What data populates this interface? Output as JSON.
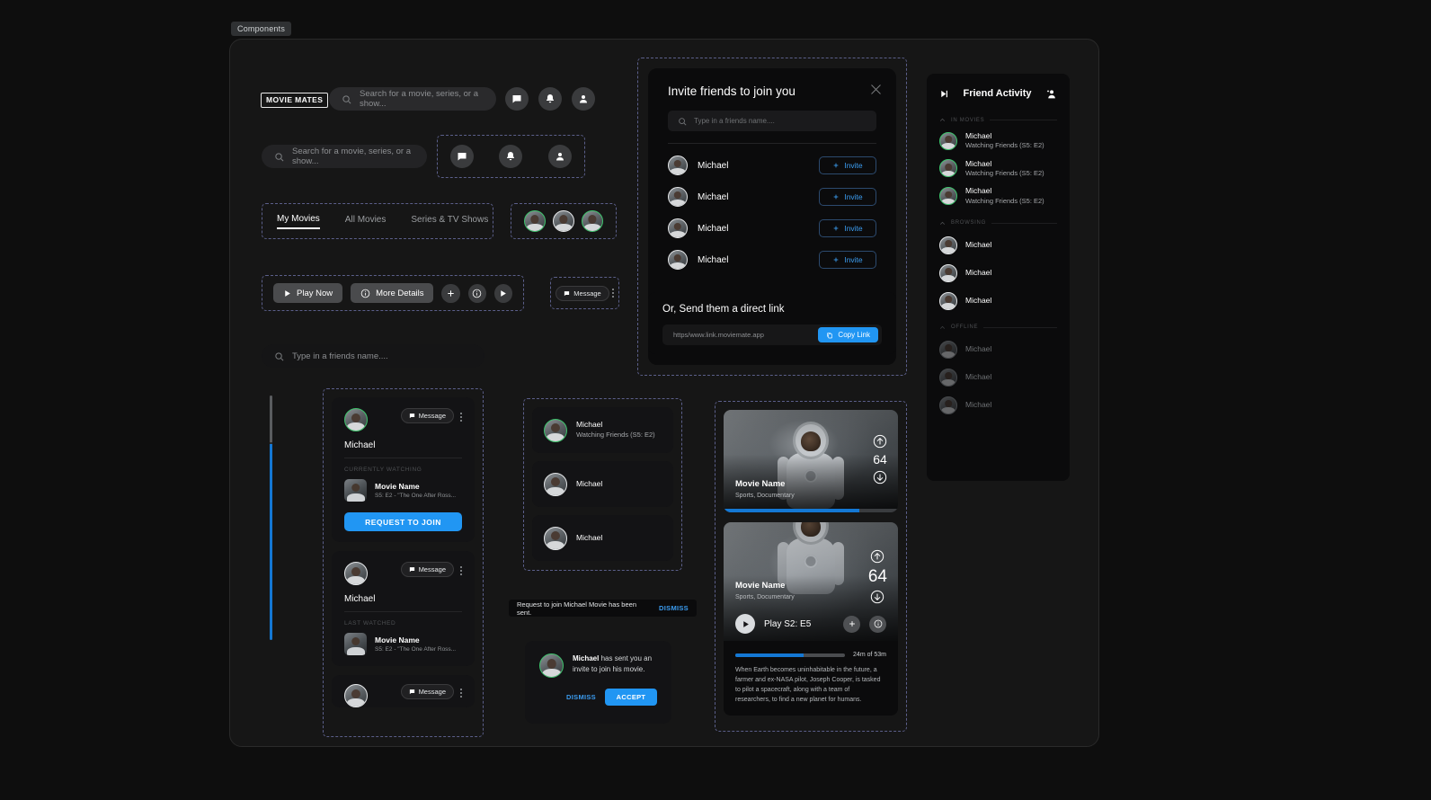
{
  "frame": {
    "label": "Components"
  },
  "header": {
    "logo": "MOVIE MATES",
    "search_placeholder": "Search for a movie, series, or a show...",
    "icons": [
      "message-icon",
      "bell-icon",
      "user-icon"
    ]
  },
  "second_search": {
    "placeholder": "Search for a movie, series, or a show..."
  },
  "friend_search": {
    "placeholder": "Type in a friends name...."
  },
  "tabs": [
    {
      "label": "My Movies",
      "active": true
    },
    {
      "label": "All Movies",
      "active": false
    },
    {
      "label": "Series & TV Shows",
      "active": false
    }
  ],
  "actions": {
    "play_now": "Play Now",
    "more_details": "More Details",
    "plus": "plus-icon",
    "info": "info-icon",
    "play": "play-icon",
    "message": "Message"
  },
  "modal": {
    "title": "Invite friends to join you",
    "search_placeholder": "Type in a friends name....",
    "close": "close-icon",
    "rows": [
      {
        "name": "Michael",
        "action": "Invite"
      },
      {
        "name": "Michael",
        "action": "Invite"
      },
      {
        "name": "Michael",
        "action": "Invite"
      },
      {
        "name": "Michael",
        "action": "Invite"
      }
    ]
  },
  "link_card": {
    "title": "Or, Send them a direct link",
    "url": "https/www.link.moviemate.app",
    "copy_label": "Copy Link"
  },
  "friend_activity": {
    "title": "Friend Activity",
    "collapse_icon": "skip-icon",
    "add_icon": "add-person-icon",
    "sections": [
      {
        "label": "IN MOVIES",
        "rows": [
          {
            "name": "Michael",
            "status": "Watching Friends (S5: E2)"
          },
          {
            "name": "Michael",
            "status": "Watching Friends (S5: E2)"
          },
          {
            "name": "Michael",
            "status": "Watching Friends (S5: E2)"
          }
        ]
      },
      {
        "label": "BROWSING",
        "rows": [
          {
            "name": "Michael",
            "status": ""
          },
          {
            "name": "Michael",
            "status": ""
          },
          {
            "name": "Michael",
            "status": ""
          }
        ]
      },
      {
        "label": "OFFLINE",
        "rows": [
          {
            "name": "Michael",
            "status": ""
          },
          {
            "name": "Michael",
            "status": ""
          },
          {
            "name": "Michael",
            "status": ""
          }
        ]
      }
    ]
  },
  "scrollbar": {
    "fill_percent": 80
  },
  "profile_cards": [
    {
      "name": "Michael",
      "message": "Message",
      "section_label": "CURRENTLY WATCHING",
      "movie_name": "Movie Name",
      "movie_sub": "S5: E2 - \"The One After Ross...",
      "cta": "REQUEST TO JOIN"
    },
    {
      "name": "Michael",
      "message": "Message",
      "section_label": "LAST WATCHED",
      "movie_name": "Movie Name",
      "movie_sub": "S5: E2 - \"The One After Ross...",
      "cta": ""
    },
    {
      "name": "",
      "message": "Message",
      "section_label": "",
      "movie_name": "",
      "movie_sub": "",
      "cta": ""
    }
  ],
  "mid_list": [
    {
      "name": "Michael",
      "status": "Watching Friends (S5: E2)"
    },
    {
      "name": "Michael",
      "status": ""
    },
    {
      "name": "Michael",
      "status": ""
    }
  ],
  "toast": {
    "text": "Request to join Michael Movie has been sent.",
    "action": "DISMISS"
  },
  "invite_notice": {
    "name": "Michael",
    "text": " has sent you an invite to join his movie.",
    "dismiss": "DISMISS",
    "accept": "ACCEPT"
  },
  "movie_cards": [
    {
      "title": "Movie Name",
      "genre": "Sports, Documentary",
      "votes": "64",
      "up_icon": "arrow-up-circle-icon",
      "down_icon": "arrow-down-circle-icon",
      "progress_percent": 78
    },
    {
      "title": "Movie Name",
      "genre": "Sports, Documentary",
      "votes": "64",
      "up_icon": "arrow-up-circle-icon",
      "down_icon": "arrow-down-circle-icon",
      "play_label": "Play S2: E5",
      "time_label": "24m of 53m",
      "progress_percent": 62,
      "description": "When Earth becomes uninhabitable in the future, a farmer and ex-NASA pilot, Joseph Cooper, is tasked to pilot a spacecraft, along with a team of researchers, to find a new planet for humans."
    }
  ],
  "colors": {
    "accent_blue": "#2196f3",
    "progress_blue": "#1478d4",
    "bg": "#0e0e0e",
    "card": "#131315",
    "panel": "#0b0b0c",
    "dashed_guide": "#5b5f8a",
    "online_green": "#3ec46d"
  }
}
